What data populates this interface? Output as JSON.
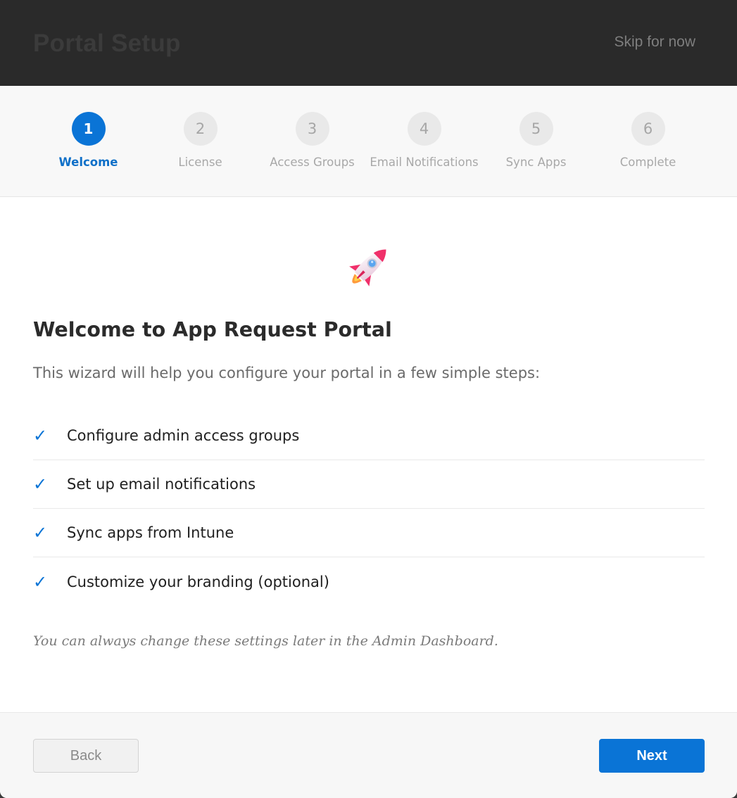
{
  "header": {
    "title": "Portal Setup",
    "skip_label": "Skip for now"
  },
  "stepper": {
    "active_step": 1,
    "steps": [
      {
        "number": "1",
        "label": "Welcome"
      },
      {
        "number": "2",
        "label": "License"
      },
      {
        "number": "3",
        "label": "Access Groups"
      },
      {
        "number": "4",
        "label": "Email Notifications"
      },
      {
        "number": "5",
        "label": "Sync Apps"
      },
      {
        "number": "6",
        "label": "Complete"
      }
    ]
  },
  "content": {
    "icon": "rocket-icon",
    "title": "Welcome to App Request Portal",
    "intro": "This wizard will help you configure your portal in a few simple steps:",
    "check_symbol": "✓",
    "checklist": [
      "Configure admin access groups",
      "Set up email notifications",
      "Sync apps from Intune",
      "Customize your branding (optional)"
    ],
    "note": "You can always change these settings later in the Admin Dashboard."
  },
  "footer": {
    "back_label": "Back",
    "next_label": "Next"
  },
  "colors": {
    "accent": "#0a74d6",
    "header_bg": "#2a2a2a",
    "stepper_bg": "#f8f8f8",
    "inactive_step": "#e9e9e9"
  }
}
